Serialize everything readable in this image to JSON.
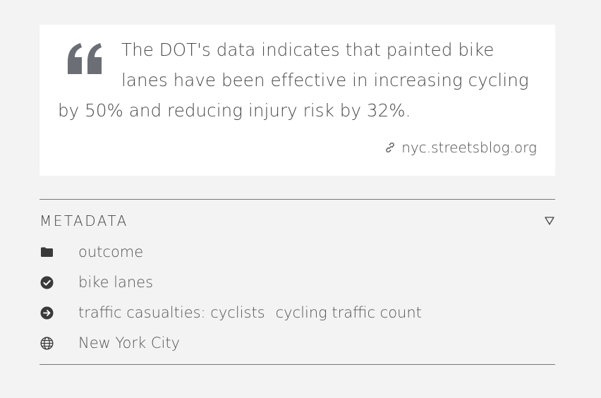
{
  "quote": {
    "text": "The DOT's data indicates that painted bike lanes have been effective in increasing cycling by 50% and reducing injury risk by 32%.",
    "source": "nyc.streetsblog.org",
    "source_icon": "link-icon",
    "quote_icon": "quote-mark-icon"
  },
  "metadata": {
    "title": "METADATA",
    "toggle_icon": "triangle-down-icon",
    "rows": [
      {
        "icon": "folder-icon",
        "values": [
          "outcome"
        ]
      },
      {
        "icon": "check-circle-icon",
        "values": [
          "bike lanes"
        ]
      },
      {
        "icon": "arrow-circle-icon",
        "values": [
          "traffic casualties: cyclists",
          "cycling traffic count"
        ]
      },
      {
        "icon": "globe-icon",
        "values": [
          "New York City"
        ]
      }
    ]
  },
  "colors": {
    "background": "#f3f3f3",
    "card": "#ffffff",
    "quote_mark": "#6b6f75",
    "text": "#4a4a4a"
  }
}
